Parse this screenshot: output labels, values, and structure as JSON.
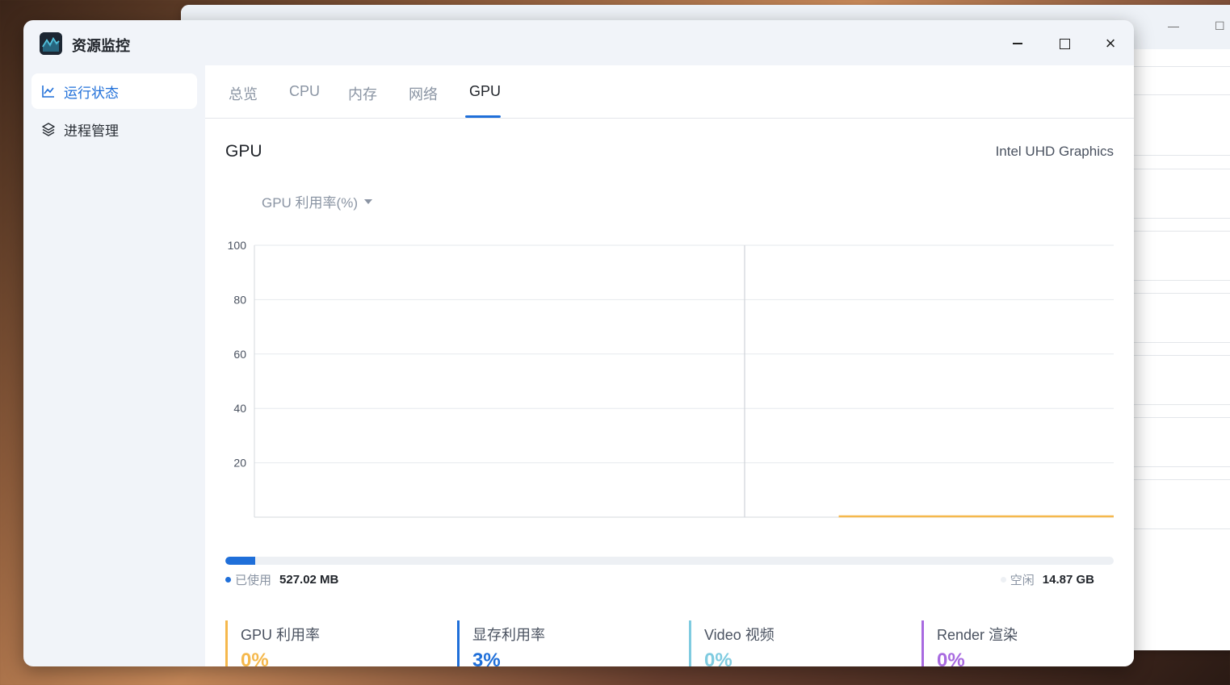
{
  "app": {
    "title": "资源监控"
  },
  "sidebar": {
    "items": [
      {
        "label": "运行状态",
        "icon": "line-chart-icon",
        "active": true
      },
      {
        "label": "进程管理",
        "icon": "layers-icon",
        "active": false
      }
    ]
  },
  "tabs": [
    {
      "label": "总览"
    },
    {
      "label": "CPU"
    },
    {
      "label": "内存"
    },
    {
      "label": "网络"
    },
    {
      "label": "GPU",
      "active": true
    }
  ],
  "gpu": {
    "title": "GPU",
    "model": "Intel UHD Graphics",
    "metric_select": "GPU 利用率(%)"
  },
  "chart_data": {
    "type": "line",
    "title": "",
    "xlabel": "",
    "ylabel": "GPU 利用率(%)",
    "ylim": [
      0,
      100
    ],
    "y_ticks": [
      "100",
      "80",
      "60",
      "40",
      "20"
    ],
    "grid": true,
    "series": [
      {
        "color": "#f5b84c",
        "x": [
          0.68,
          1.0
        ],
        "values": [
          0,
          0
        ]
      }
    ]
  },
  "memory": {
    "used_label": "已使用",
    "used_value": "527.02 MB",
    "free_label": "空闲",
    "free_value": "14.87 GB",
    "used_fraction": 0.034,
    "used_color": "#1f6fd9"
  },
  "stats": [
    {
      "label": "GPU 利用率",
      "value": "0%",
      "color": "#f5b84c"
    },
    {
      "label": "显存利用率",
      "value": "3%",
      "color": "#1f6fd9"
    },
    {
      "label": "Video  视频",
      "value": "0%",
      "color": "#7fcbe0"
    },
    {
      "label": "Render  渲染",
      "value": "0%",
      "color": "#a86ae0"
    }
  ]
}
